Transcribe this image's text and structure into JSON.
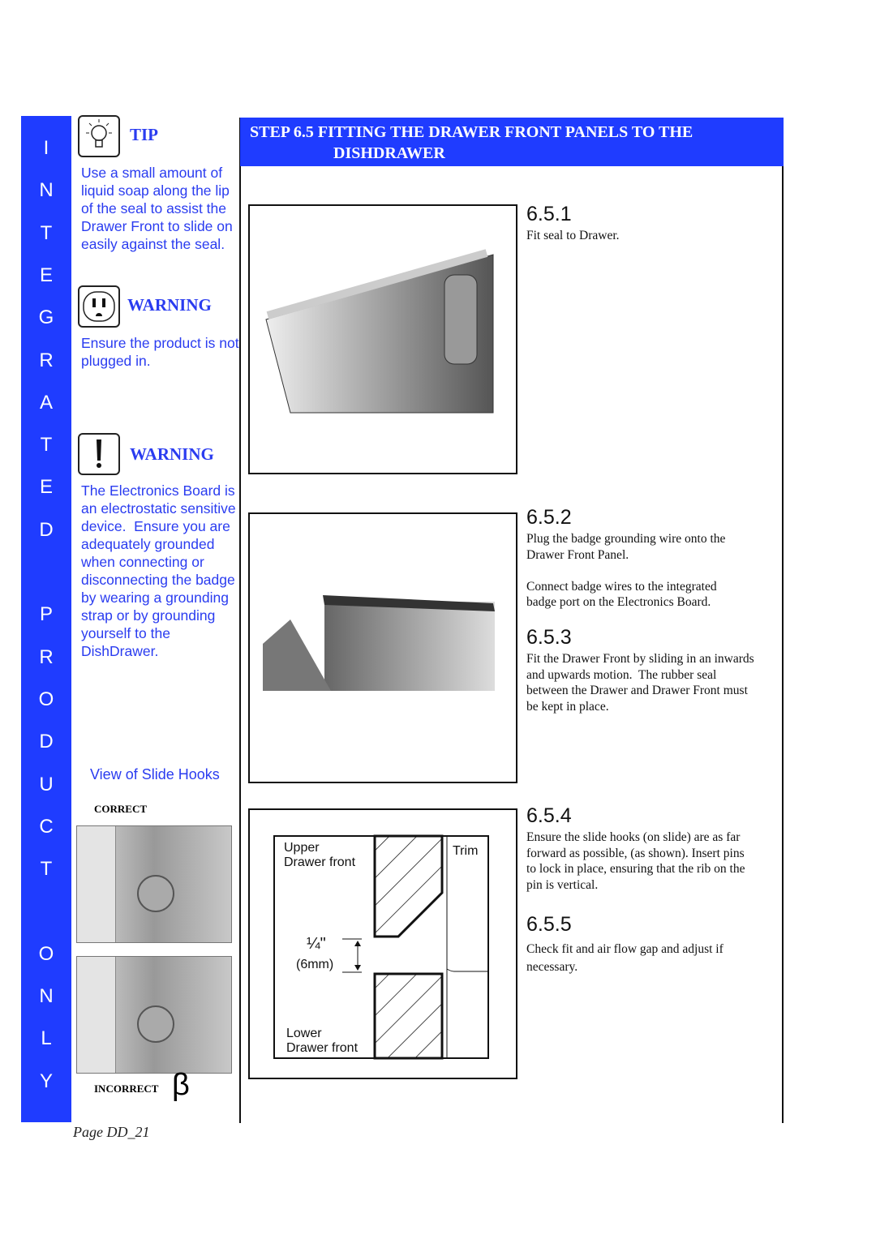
{
  "sidebar": {
    "letters": [
      "I",
      "N",
      "T",
      "E",
      "G",
      "R",
      "A",
      "T",
      "E",
      "D",
      "",
      "P",
      "R",
      "O",
      "D",
      "U",
      "C",
      "T",
      "",
      "O",
      "N",
      "L",
      "Y"
    ]
  },
  "tip": {
    "icon": "lightbulb-icon",
    "heading": "TIP",
    "text": "Use a small amount of\nliquid soap along the lip\nof the seal to assist the\nDrawer Front to slide on\neasily against the seal."
  },
  "warning1": {
    "icon": "power-outlet-icon",
    "heading": "WARNING",
    "text": "Ensure the product is not\nplugged in."
  },
  "warning2": {
    "icon": "exclamation-icon",
    "heading": "WARNING",
    "text": "The Electronics Board is\nan electrostatic sensitive\ndevice.  Ensure you are\nadequately grounded\nwhen connecting or\ndisconnecting the badge\nby wearing a grounding\nstrap or by grounding\nyourself to the\nDishDrawer."
  },
  "slide_hooks": {
    "title": "View of Slide Hooks",
    "correct": "CORRECT",
    "incorrect": "INCORRECT",
    "incorrect_mark": "β"
  },
  "step": {
    "title_line1": "STEP  6.5  FITTING  THE  DRAWER FRONT PANELS  TO THE",
    "title_line2": "DISHDRAWER"
  },
  "steps": [
    {
      "num": "6.5.1",
      "text": "Fit seal to Drawer."
    },
    {
      "num": "6.5.2",
      "text": "Plug the badge grounding wire onto the\nDrawer Front  Panel.\n\nConnect badge wires to the integrated\nbadge port on the Electronics Board."
    },
    {
      "num": "6.5.3",
      "text": "Fit the Drawer Front by sliding in an inwards\nand upwards motion.  The rubber seal\nbetween the Drawer and Drawer Front must\nbe kept in place."
    },
    {
      "num": "6.5.4",
      "text": "Ensure the slide hooks (on slide) are as far\nforward as possible, (as shown). Insert pins\nto lock in place, ensuring that the rib on the\npin is vertical."
    },
    {
      "num": "6.5.5",
      "text": "Check fit and air flow gap and adjust if\nnecessary."
    }
  ],
  "diagram": {
    "upper": "Upper\nDrawer front",
    "lower": "Lower\nDrawer front",
    "trim": "Trim",
    "gap_fraction": "¼\"",
    "gap_mm": "(6mm)"
  },
  "footer": {
    "page": "Page DD_21"
  }
}
